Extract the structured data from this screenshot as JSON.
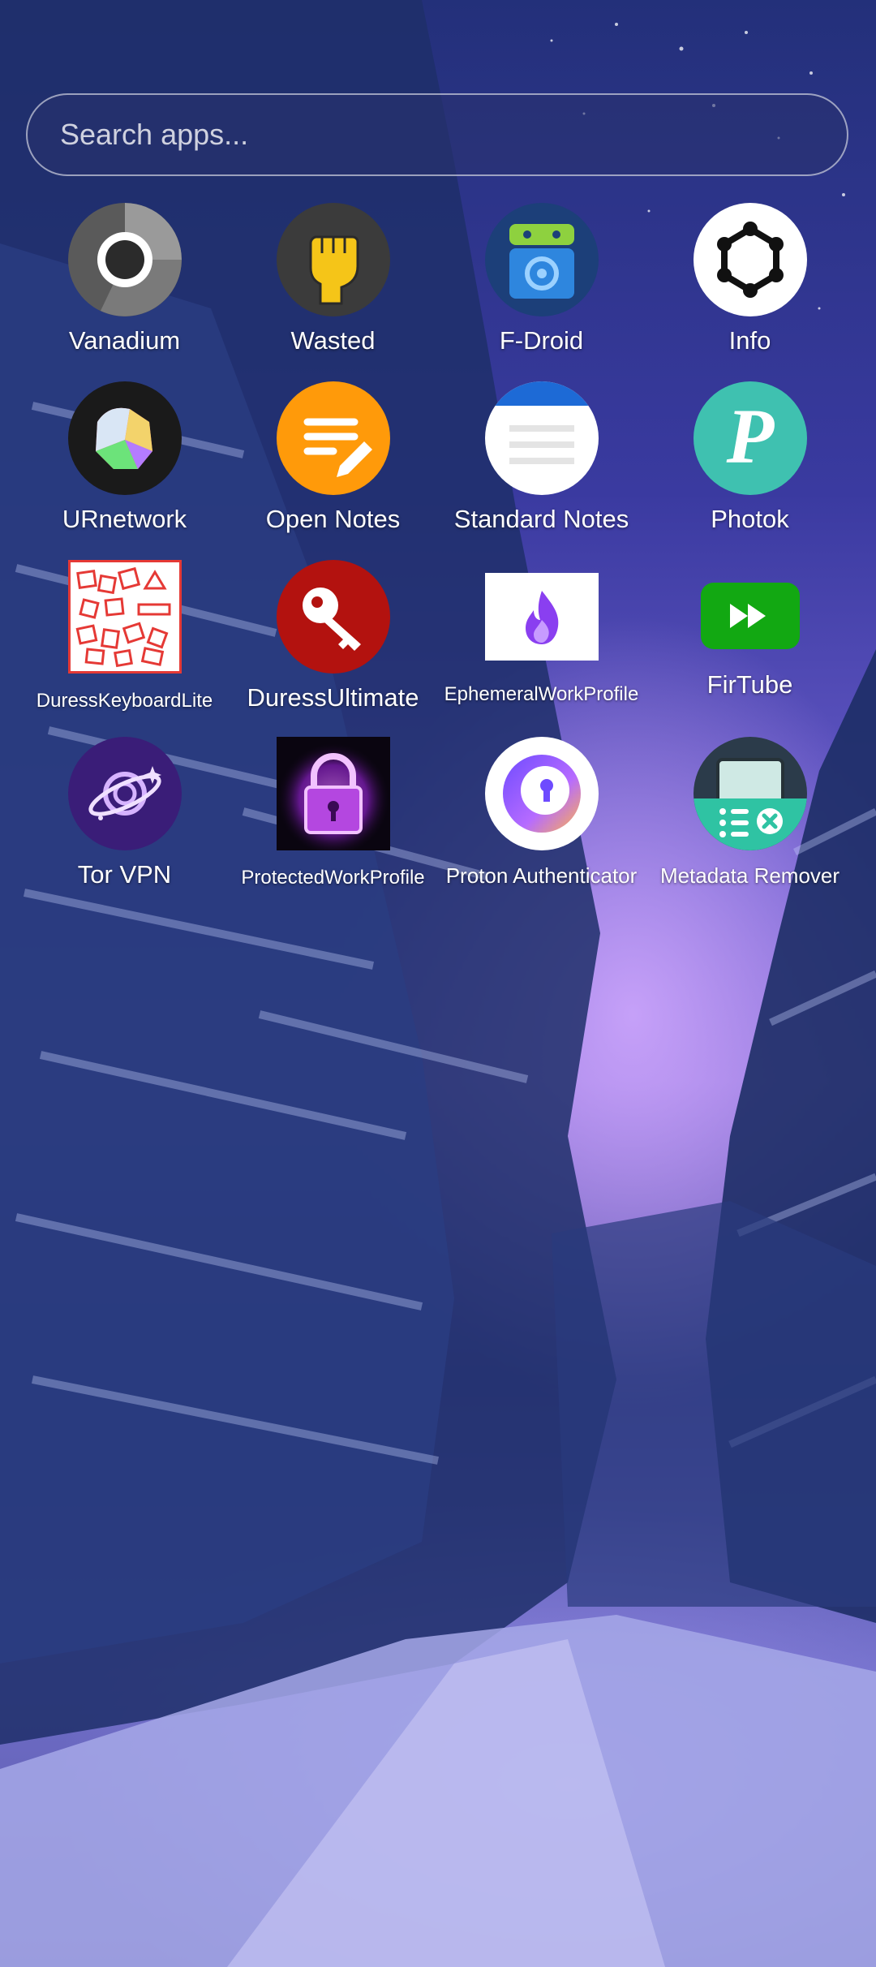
{
  "search": {
    "placeholder": "Search apps..."
  },
  "apps": [
    {
      "label": "Vanadium",
      "icon": "vanadium-icon"
    },
    {
      "label": "Wasted",
      "icon": "raised-fist-icon"
    },
    {
      "label": "F-Droid",
      "icon": "fdroid-robot-icon"
    },
    {
      "label": "Info",
      "icon": "hexagon-molecule-icon"
    },
    {
      "label": "URnetwork",
      "icon": "urnetwork-icon"
    },
    {
      "label": "Open Notes",
      "icon": "note-pencil-icon"
    },
    {
      "label": "Standard Notes",
      "icon": "notes-lines-icon"
    },
    {
      "label": "Photok",
      "icon": "photok-p-icon"
    },
    {
      "label": "DuressKeyboardLite",
      "icon": "duress-keyboard-icon"
    },
    {
      "label": "DuressUltimate",
      "icon": "key-icon"
    },
    {
      "label": "EphemeralWorkProfile",
      "icon": "flame-icon"
    },
    {
      "label": "FirTube",
      "icon": "fast-forward-icon"
    },
    {
      "label": "Tor VPN",
      "icon": "planet-icon"
    },
    {
      "label": "ProtectedWorkProfile",
      "icon": "purple-lock-icon"
    },
    {
      "label": "Proton Authenticator",
      "icon": "proton-auth-icon"
    },
    {
      "label": "Metadata Remover",
      "icon": "metadata-remover-icon"
    }
  ]
}
